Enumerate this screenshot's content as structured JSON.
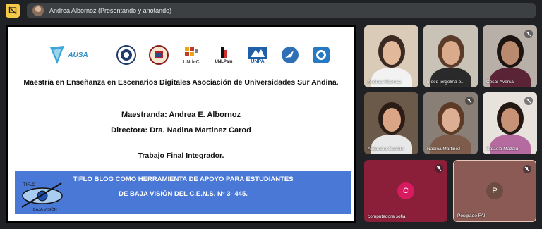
{
  "presenter": {
    "label": "Andrea Albornoz (Presentando y anotando)"
  },
  "slide": {
    "title": "Maestría en Enseñanza en Escenarios Digitales Asociación de Universidades Sur Andina.",
    "maestranda": "Maestranda: Andrea E. Albornoz",
    "directora": "Directora: Dra. Nadina Martinez Carod",
    "trabajo": "Trabajo Final Integrador.",
    "banner_line1": "TIFLO BLOG COMO HERRAMIENTA DE APOYO PARA ESTUDIANTES",
    "banner_line2": "DE BAJA VISIÓN DEL C.E.N.S. N° 3- 445.",
    "logo_texts": {
      "ausa": "AUSA",
      "unidec": "UNdeC",
      "unlpam": "UNLPam",
      "unpa": "UNPA"
    },
    "eye_logo_top": "TIFLO",
    "eye_logo_bottom": "BAJA VISIÓN"
  },
  "participants": [
    {
      "name": "Andrea Albornoz",
      "bg": "#d9cbb8",
      "skin": "#e2b89a",
      "hair": "#3b2a22",
      "shirt": "#f2f2f2"
    },
    {
      "name": "meed jorgelina p...",
      "bg": "#c9c2b6",
      "skin": "#d9aa8c",
      "hair": "#5a3b29",
      "shirt": "#2a2a2a"
    },
    {
      "name": "César Aversa",
      "bg": "#b8b0a8",
      "skin": "#b98a6e",
      "hair": "#1c1410",
      "shirt": "#5a2436",
      "muted": true
    },
    {
      "name": "Alejandra Garrido",
      "bg": "#6b5a4a",
      "skin": "#d9a586",
      "hair": "#2b1d16",
      "shirt": "#e8e8e8"
    },
    {
      "name": "Nadina Martinez",
      "bg": "#8a7f76",
      "skin": "#dcae94",
      "hair": "#5c3a26",
      "shirt": "#7d5c4b",
      "muted": true
    },
    {
      "name": "Rafaela Mazalu",
      "bg": "#e8e2dc",
      "skin": "#c79276",
      "hair": "#231814",
      "shirt": "#b56aa0",
      "muted": true
    },
    {
      "name": "computadora sofia",
      "initial": "C",
      "bg": "#8b1f3a",
      "avatar_color": "#d81b60",
      "muted": true
    },
    {
      "name": "Posgrado FAI",
      "initial": "P",
      "bg": "#8b5a54",
      "avatar_color": "#6d4c41",
      "muted": true
    }
  ]
}
